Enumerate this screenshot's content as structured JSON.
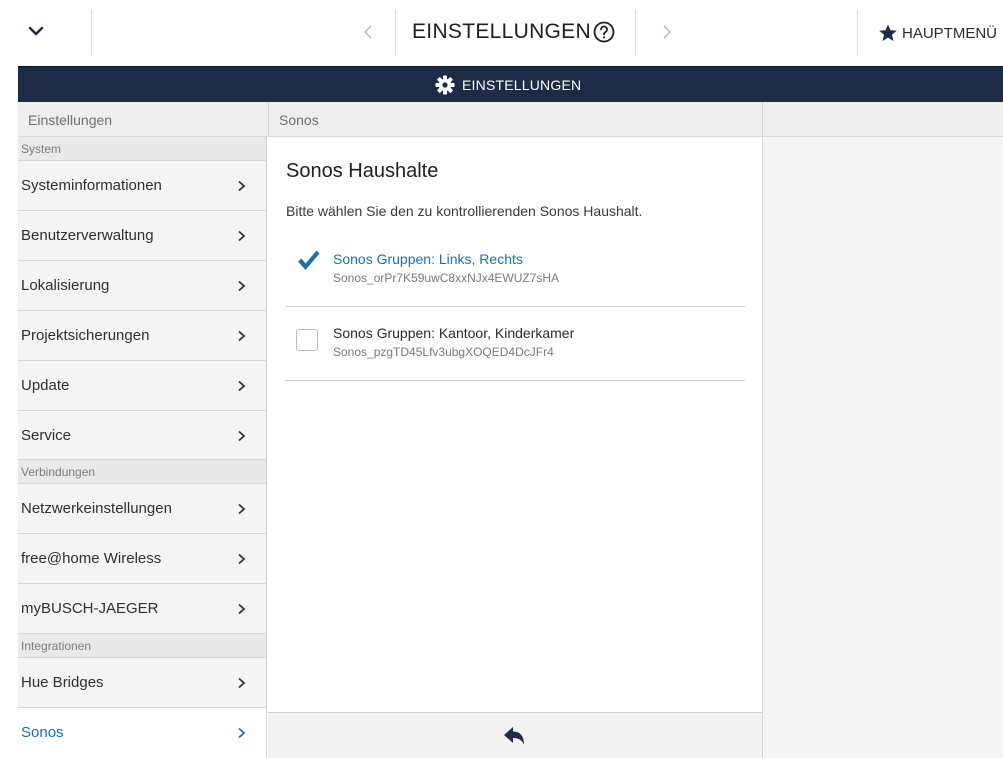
{
  "topbar": {
    "title": "EINSTELLUNGEN",
    "main_menu_label": "HAUPTMENÜ"
  },
  "header": {
    "title": "EINSTELLUNGEN"
  },
  "sidebar": {
    "column_title": "Einstellungen",
    "sections": [
      {
        "title": "System",
        "items": [
          "Systeminformationen",
          "Benutzerverwaltung",
          "Lokalisierung",
          "Projektsicherungen",
          "Update",
          "Service"
        ]
      },
      {
        "title": "Verbindungen",
        "items": [
          "Netzwerkeinstellungen",
          "free@home Wireless",
          "myBUSCH-JAEGER"
        ]
      },
      {
        "title": "Integrationen",
        "items": [
          "Hue Bridges",
          "Sonos"
        ]
      }
    ],
    "active_item": "Sonos"
  },
  "main": {
    "column_title": "Sonos",
    "title": "Sonos Haushalte",
    "subtitle": "Bitte wählen Sie den zu kontrollierenden Sonos Haushalt.",
    "households": [
      {
        "name": "Sonos Gruppen: Links, Rechts",
        "id": "Sonos_orPr7K59uwC8xxNJx4EWUZ7sHA",
        "selected": true
      },
      {
        "name": "Sonos Gruppen: Kantoor, Kinderkamer",
        "id": "Sonos_pzgTD45Lfv3ubgXOQED4DcJFr4",
        "selected": false
      }
    ]
  },
  "colors": {
    "header_bg": "#1d2c45",
    "accent": "#1d6fae",
    "text": "#2b2b2b"
  },
  "icons": {
    "dropdown": "chevron-down-icon",
    "prev": "chevron-left-icon",
    "next": "chevron-right-icon",
    "help": "help-circle-icon",
    "favorite": "star-icon",
    "settings": "gear-icon",
    "back": "reply-arrow-icon",
    "selected": "checkmark-icon"
  }
}
